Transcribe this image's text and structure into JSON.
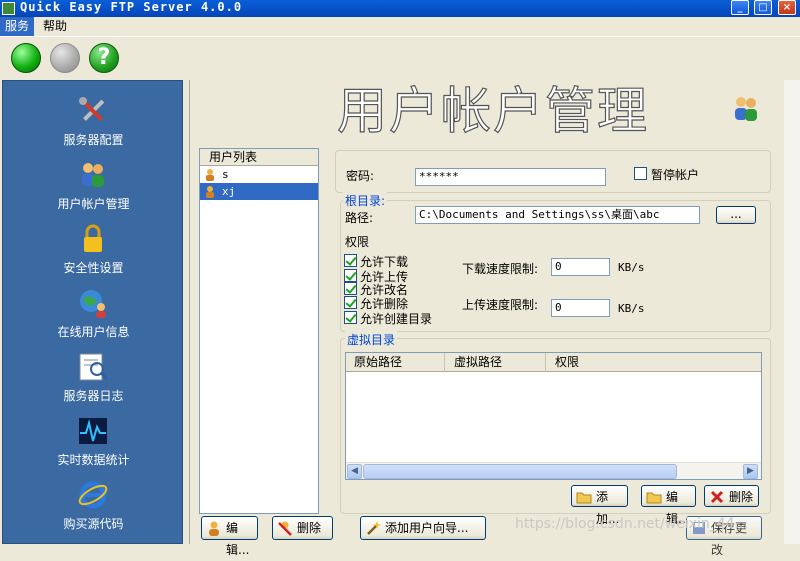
{
  "window": {
    "title": "Quick Easy FTP Server 4.0.0"
  },
  "menu": [
    "服务",
    "帮助"
  ],
  "toolbar": {
    "help_glyph": "?"
  },
  "sidebar": {
    "items": [
      {
        "label": "服务器配置",
        "icon": "tools-icon"
      },
      {
        "label": "用户帐户管理",
        "icon": "users-icon"
      },
      {
        "label": "安全性设置",
        "icon": "lock-icon"
      },
      {
        "label": "在线用户信息",
        "icon": "globe-users-icon"
      },
      {
        "label": "服务器日志",
        "icon": "log-icon"
      },
      {
        "label": "实时数据统计",
        "icon": "stats-icon"
      },
      {
        "label": "购买源代码",
        "icon": "ie-icon"
      }
    ]
  },
  "main": {
    "heading": "用户帐户管理",
    "user_list": {
      "header": "用户列表",
      "users": [
        "s",
        "xj"
      ],
      "selected": 1
    },
    "password": {
      "label": "密码:",
      "value": "******"
    },
    "suspend": {
      "label": "暂停帐户",
      "checked": false
    },
    "root": {
      "legend": "根目录:",
      "path_label": "路径:",
      "path_value": "C:\\Documents and Settings\\ss\\桌面\\abc",
      "browse_label": "..."
    },
    "permissions": {
      "title": "权限",
      "items": [
        {
          "label": "允许下载",
          "checked": true
        },
        {
          "label": "允许上传",
          "checked": true
        },
        {
          "label": "允许改名",
          "checked": true
        },
        {
          "label": "允许删除",
          "checked": true
        },
        {
          "label": "允许创建目录",
          "checked": true
        }
      ]
    },
    "download_limit": {
      "label": "下载速度限制:",
      "value": "0",
      "unit": "KB/s"
    },
    "upload_limit": {
      "label": "上传速度限制:",
      "value": "0",
      "unit": "KB/s"
    },
    "virtual_dir": {
      "legend": "虚拟目录",
      "columns": [
        "原始路径",
        "虚拟路径",
        "权限"
      ],
      "add_label": "添加...",
      "edit_label": "编辑...",
      "delete_label": "删除"
    },
    "bottom_buttons": {
      "edit_label": "编辑...",
      "delete_label": "删除",
      "wizard_label": "添加用户向导...",
      "save_label": "保存更改"
    },
    "watermark": "https://blog.csdn.net/weixin_44..."
  },
  "colors": {
    "titlebar": "#0a5fd8",
    "sidebar": "#3b69a1",
    "selection": "#316ac5"
  }
}
